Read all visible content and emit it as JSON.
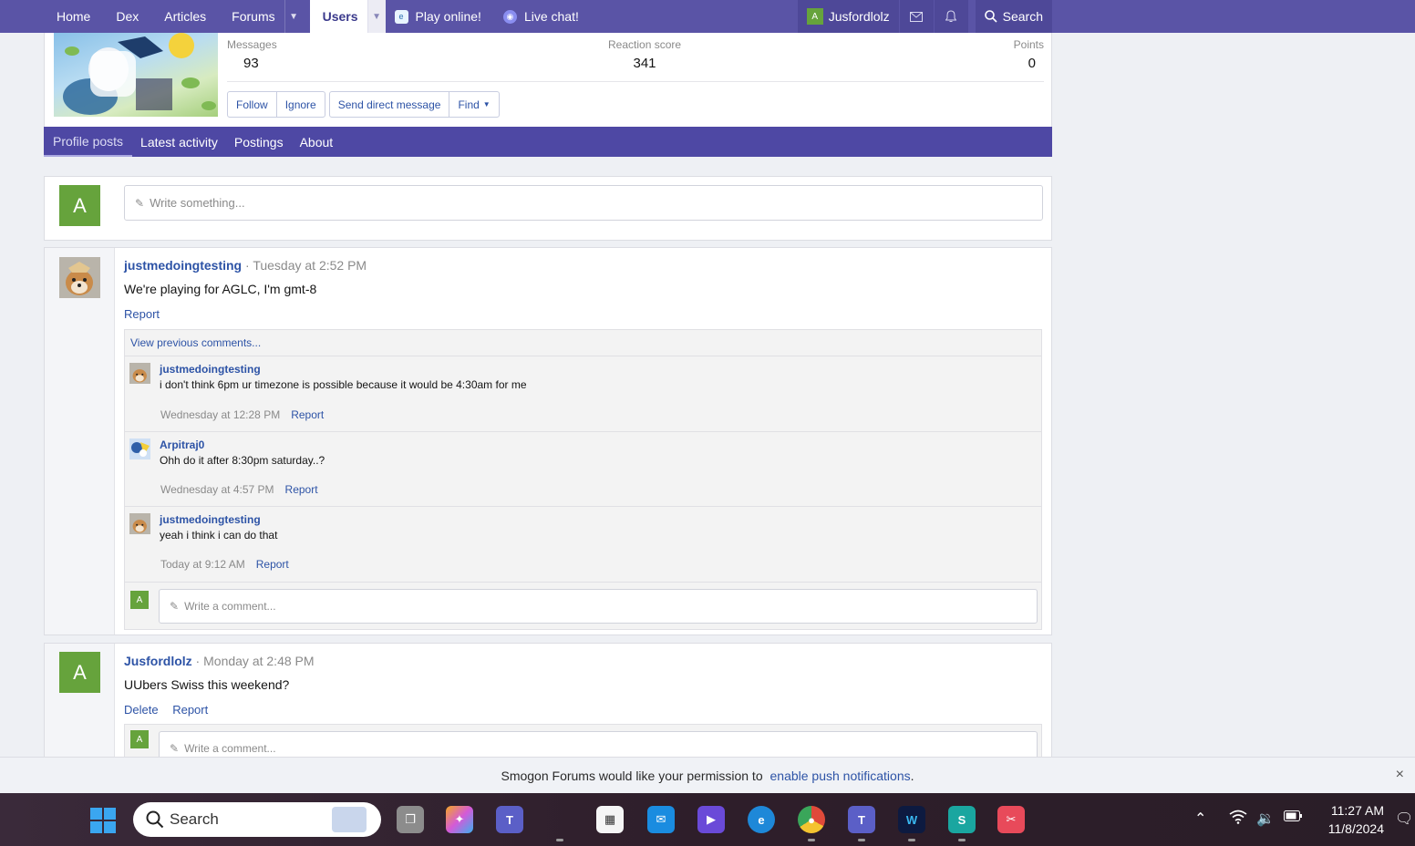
{
  "nav": {
    "tabs": [
      {
        "label": "Home"
      },
      {
        "label": "Dex"
      },
      {
        "label": "Articles"
      },
      {
        "label": "Forums"
      },
      {
        "label": "Users"
      },
      {
        "label": "Play online!"
      },
      {
        "label": "Live chat!"
      }
    ],
    "user": {
      "initial": "A",
      "name": "Jusfordlolz"
    },
    "search_label": "Search"
  },
  "profile": {
    "stats": [
      {
        "label": "Messages",
        "value": "93"
      },
      {
        "label": "Reaction score",
        "value": "341"
      },
      {
        "label": "Points",
        "value": "0"
      }
    ],
    "buttons": {
      "follow": "Follow",
      "ignore": "Ignore",
      "send_dm": "Send direct message",
      "find": "Find"
    },
    "subtabs": [
      "Profile posts",
      "Latest activity",
      "Postings",
      "About"
    ]
  },
  "write_box": {
    "initial": "A",
    "placeholder": "Write something..."
  },
  "posts": [
    {
      "user": "justmedoingtesting",
      "time": "Tuesday at 2:52 PM",
      "text": "We're playing for AGLC, I'm gmt-8",
      "actions": [
        "Report"
      ],
      "view_previous": "View previous comments...",
      "comments": [
        {
          "user": "justmedoingtesting",
          "text": "i don't think 6pm ur timezone is possible because it would be 4:30am for me",
          "time": "Wednesday at 12:28 PM",
          "report": "Report"
        },
        {
          "user": "Arpitraj0",
          "text": "Ohh do it after 8:30pm saturday..?",
          "time": "Wednesday at 4:57 PM",
          "report": "Report"
        },
        {
          "user": "justmedoingtesting",
          "text": "yeah i think i can do that",
          "time": "Today at 9:12 AM",
          "report": "Report"
        }
      ],
      "comment_placeholder": "Write a comment..."
    },
    {
      "user": "Jusfordlolz",
      "initial": "A",
      "time": "Monday at 2:48 PM",
      "text": "UUbers Swiss this weekend?",
      "actions": [
        "Delete",
        "Report"
      ],
      "comment_placeholder": "Write a comment..."
    }
  ],
  "notification": {
    "text": "Smogon Forums would like your permission to ",
    "link": "enable push notifications",
    "suffix": ".",
    "close": "×"
  },
  "taskbar": {
    "search": "Search",
    "time": "11:27 AM",
    "date": "11/8/2024"
  }
}
